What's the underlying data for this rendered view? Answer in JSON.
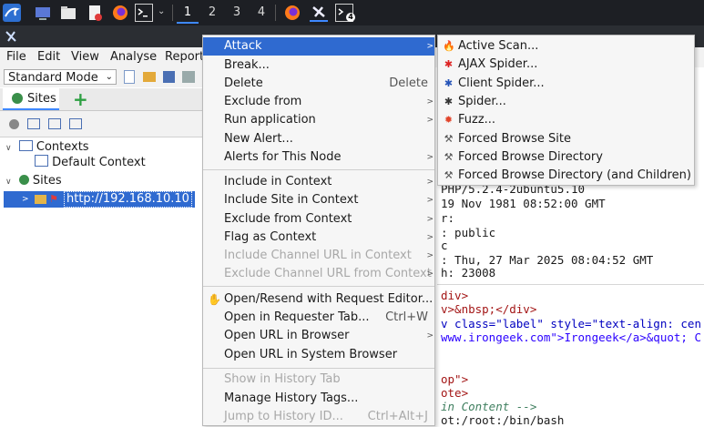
{
  "taskbar": {
    "workspaces": [
      "1",
      "2",
      "3",
      "4"
    ],
    "terminal_badge": "4"
  },
  "window": {
    "title": ""
  },
  "menubar": [
    "File",
    "Edit",
    "View",
    "Analyse",
    "Report"
  ],
  "toolbar": {
    "mode": "Standard Mode"
  },
  "sites_panel": {
    "tab_label": "Sites",
    "tree": {
      "contexts": "Contexts",
      "default_context": "Default Context",
      "sites": "Sites",
      "host": "http://192.168.10.10"
    }
  },
  "context_menu": {
    "items": [
      {
        "label": "Attack",
        "submenu": true
      },
      {
        "label": "Break..."
      },
      {
        "label": "Delete",
        "shortcut": "Delete"
      },
      {
        "label": "Exclude from",
        "submenu": true
      },
      {
        "label": "Run application",
        "submenu": true
      },
      {
        "label": "New Alert..."
      },
      {
        "label": "Alerts for This Node",
        "submenu": true
      },
      {
        "label": "Include in Context",
        "submenu": true
      },
      {
        "label": "Include Site in Context",
        "submenu": true
      },
      {
        "label": "Exclude from Context",
        "submenu": true
      },
      {
        "label": "Flag as Context",
        "submenu": true
      },
      {
        "label": "Include Channel URL in Context",
        "submenu": true,
        "disabled": true
      },
      {
        "label": "Exclude Channel URL from Context",
        "submenu": true,
        "disabled": true
      },
      {
        "label": "Open/Resend with Request Editor..."
      },
      {
        "label": "Open in Requester Tab...",
        "shortcut": "Ctrl+W"
      },
      {
        "label": "Open URL in Browser",
        "submenu": true
      },
      {
        "label": "Open URL in System Browser"
      },
      {
        "label": "Show in History Tab",
        "disabled": true
      },
      {
        "label": "Manage History Tags..."
      },
      {
        "label": "Jump to History ID...",
        "shortcut": "Ctrl+Alt+J",
        "disabled": true
      }
    ]
  },
  "attack_submenu": {
    "items": [
      {
        "label": "Active Scan...",
        "icon": "flame-icon"
      },
      {
        "label": "AJAX Spider...",
        "icon": "red-spider-icon"
      },
      {
        "label": "Client Spider...",
        "icon": "blue-spider-icon"
      },
      {
        "label": "Spider...",
        "icon": "spider-icon"
      },
      {
        "label": "Fuzz...",
        "icon": "fuzz-icon"
      },
      {
        "label": "Forced Browse Site",
        "icon": "hammer-icon"
      },
      {
        "label": "Forced Browse Directory",
        "icon": "hammer-icon"
      },
      {
        "label": "Forced Browse Directory (and Children)",
        "icon": "hammer-icon"
      }
    ]
  },
  "response_header": [
    "PHP/5.2.4-2ubuntu5.10",
    "19 Nov 1981 08:52:00 GMT",
    "r:",
    ": public",
    "c",
    ": Thu, 27 Mar 2025 08:04:52 GMT",
    "h: 23008"
  ],
  "response_body": {
    "l1": "div>",
    "l2a": "v>&nbsp;</div>",
    "l3a": "v class=\"label\" style=\"text-align: cen",
    "l4a": "www.irongeek.com\">Irongeek</a>&quot; C",
    "l5": "op\">",
    "l6": "ote>",
    "l7": "in Content -->",
    "l8": "ot:/root:/bin/bash"
  },
  "colors": {
    "highlight": "#2f6ad0",
    "taskbar": "#1d1f24"
  }
}
